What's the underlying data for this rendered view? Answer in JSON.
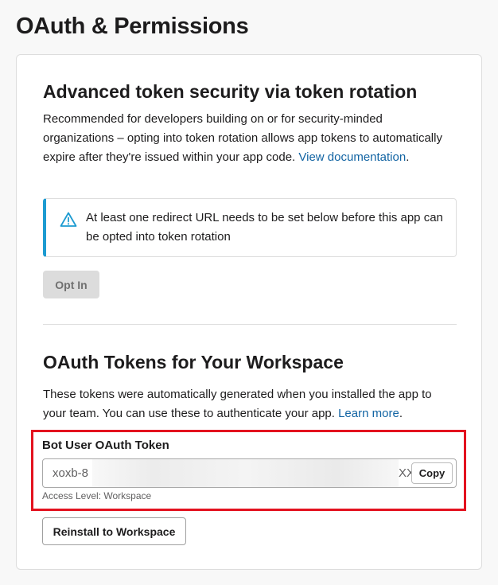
{
  "page": {
    "title": "OAuth & Permissions"
  },
  "token_rotation": {
    "title": "Advanced token security via token rotation",
    "description": "Recommended for developers building on or for security-minded organizations – opting into token rotation allows app tokens to automatically expire after they're issued within your app code.",
    "link_text": "View documentation",
    "after_link": ".",
    "alert_text": "At least one redirect URL needs to be set below before this app can be opted into token rotation",
    "opt_in_label": "Opt In"
  },
  "oauth_tokens": {
    "title": "OAuth Tokens for Your Workspace",
    "description": "These tokens were automatically generated when you installed the app to your team. You can use these to authenticate your app.",
    "link_text": "Learn more",
    "after_link": ".",
    "bot_token": {
      "label": "Bot User OAuth Token",
      "value_prefix": "xoxb-8",
      "value_suffix": "XX",
      "copy_label": "Copy",
      "access_level": "Access Level: Workspace"
    },
    "reinstall_label": "Reinstall to Workspace"
  },
  "colors": {
    "link": "#1264a3",
    "alert_accent": "#1d9bd1",
    "highlight_border": "#e3121f"
  },
  "icons": {
    "alert": "warning-triangle-icon"
  }
}
